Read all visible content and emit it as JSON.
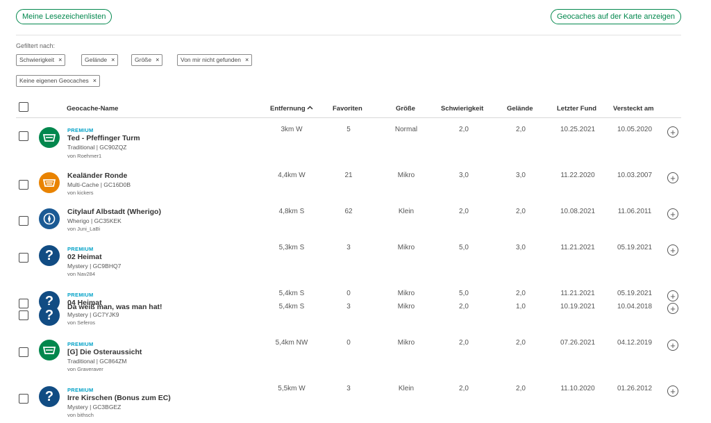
{
  "header": {
    "lists_button": "Meine Lesezeichenlisten",
    "map_button": "Geocaches auf der Karte anzeigen"
  },
  "filters": {
    "label": "Gefiltert nach:",
    "chips": [
      "Schwierigkeit",
      "Gelände",
      "Größe",
      "Von mir nicht gefunden",
      "Keine eigenen Geocaches"
    ],
    "remove_glyph": "×"
  },
  "table": {
    "columns": {
      "name": "Geocache-Name",
      "distance": "Entfernung",
      "favorites": "Favoriten",
      "size": "Größe",
      "difficulty": "Schwierigkeit",
      "terrain": "Gelände",
      "last_found": "Letzter Fund",
      "hidden": "Versteckt am"
    },
    "sort_indicator": "^",
    "rows": [
      {
        "premium": "PREMIUM",
        "name": "Ted - Pfeffinger Turm",
        "type": "Traditional | GC90ZQZ",
        "owner": "von Roehmer1",
        "distance": "3km W",
        "favorites": "5",
        "size": "Normal",
        "difficulty": "2,0",
        "terrain": "2,0",
        "last_found": "10.25.2021",
        "hidden": "10.05.2020",
        "icon": "traditional-icon"
      },
      {
        "premium": "",
        "name": "Kealänder Ronde",
        "type": "Multi-Cache | GC16D0B",
        "owner": "von kickers",
        "distance": "4,4km W",
        "favorites": "21",
        "size": "Mikro",
        "difficulty": "3,0",
        "terrain": "3,0",
        "last_found": "11.22.2020",
        "hidden": "10.03.2007",
        "icon": "multi-cache-icon"
      },
      {
        "premium": "",
        "name": "Citylauf Albstadt (Wherigo)",
        "type": "Wherigo | GC35KEK",
        "owner": "von Juni_LaBi",
        "distance": "4,8km S",
        "favorites": "62",
        "size": "Klein",
        "difficulty": "2,0",
        "terrain": "2,0",
        "last_found": "10.08.2021",
        "hidden": "11.06.2011",
        "icon": "wherigo-icon"
      },
      {
        "premium": "PREMIUM",
        "name": "02 Heimat",
        "type": "Mystery | GC9BHQ7",
        "owner": "von Nav284",
        "distance": "5,3km S",
        "favorites": "3",
        "size": "Mikro",
        "difficulty": "5,0",
        "terrain": "3,0",
        "last_found": "11.21.2021",
        "hidden": "05.19.2021",
        "icon": "mystery-icon"
      },
      {
        "premium": "PREMIUM",
        "name": "04 Heimat",
        "type": "",
        "owner": "",
        "distance": "5,4km S",
        "favorites": "0",
        "size": "Mikro",
        "difficulty": "5,0",
        "terrain": "2,0",
        "last_found": "11.21.2021",
        "hidden": "05.19.2021",
        "icon": "mystery-icon"
      },
      {
        "premium": "",
        "name": "Da weiß man, was man hat!",
        "type": "Mystery | GC7YJK9",
        "owner": "von Seferos",
        "distance": "5,4km S",
        "favorites": "3",
        "size": "Mikro",
        "difficulty": "2,0",
        "terrain": "1,0",
        "last_found": "10.19.2021",
        "hidden": "10.04.2018",
        "icon": "mystery-icon"
      },
      {
        "premium": "PREMIUM",
        "name": "[G] Die Osteraussicht",
        "type": "Traditional | GC864ZM",
        "owner": "von Graveraver",
        "distance": "5,4km NW",
        "favorites": "0",
        "size": "Mikro",
        "difficulty": "2,0",
        "terrain": "2,0",
        "last_found": "07.26.2021",
        "hidden": "04.12.2019",
        "icon": "traditional-icon"
      },
      {
        "premium": "PREMIUM",
        "name": "Irre Kirschen (Bonus zum EC)",
        "type": "Mystery | GC3BGEZ",
        "owner": "von bithsch",
        "distance": "5,5km W",
        "favorites": "3",
        "size": "Klein",
        "difficulty": "2,0",
        "terrain": "2,0",
        "last_found": "11.10.2020",
        "hidden": "01.26.2012",
        "icon": "mystery-icon"
      }
    ]
  },
  "colors": {
    "accent": "#02874d",
    "premium": "#00a1c7",
    "mystery": "#114c83",
    "multi": "#e98300"
  }
}
